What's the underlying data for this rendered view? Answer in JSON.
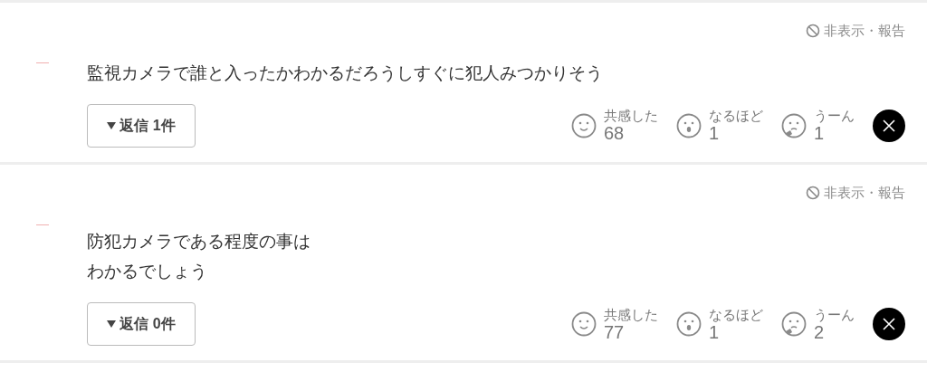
{
  "comments": [
    {
      "hide_report": "非表示・報告",
      "text": [
        "監視カメラで誰と入ったかわかるだろうしすぐに犯人みつかりそう"
      ],
      "replies": "返信 1件",
      "reactions": [
        {
          "kind": "smile",
          "label": "共感した",
          "count": "68"
        },
        {
          "kind": "surprised",
          "label": "なるほど",
          "count": "1"
        },
        {
          "kind": "thinking",
          "label": "うーん",
          "count": "1"
        }
      ]
    },
    {
      "hide_report": "非表示・報告",
      "text": [
        "防犯カメラである程度の事は",
        "わかるでしょう"
      ],
      "replies": "返信 0件",
      "reactions": [
        {
          "kind": "smile",
          "label": "共感した",
          "count": "77"
        },
        {
          "kind": "surprised",
          "label": "なるほど",
          "count": "1"
        },
        {
          "kind": "thinking",
          "label": "うーん",
          "count": "2"
        }
      ]
    }
  ]
}
